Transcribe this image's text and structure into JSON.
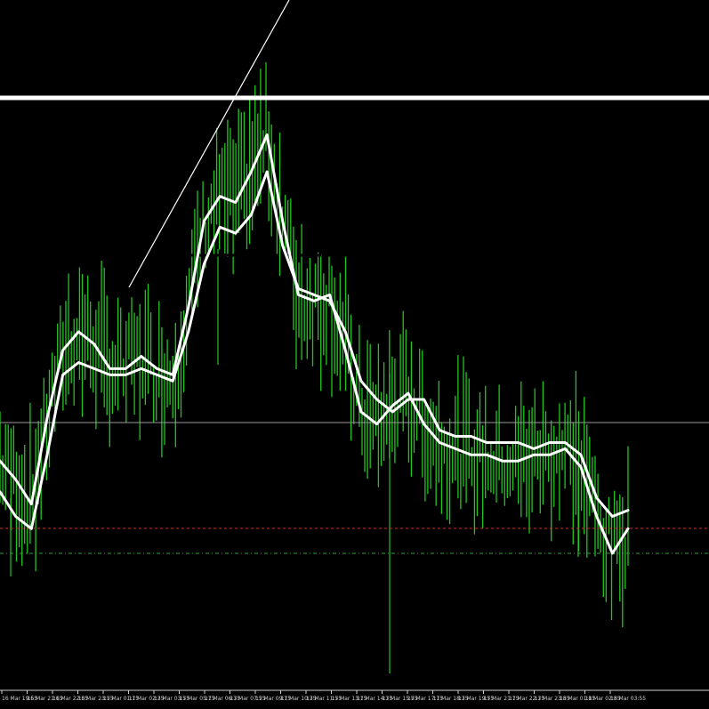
{
  "colors": {
    "background": "#000000",
    "price": "#22c41e",
    "ma": "#ffffff",
    "hline_major": "#ffffff",
    "hline_minor": "#9a9a9a",
    "hline_red": "#c0392b",
    "hline_green": "#2e9e3a",
    "axis": "#cfcfcf"
  },
  "chart_data": {
    "type": "line",
    "grid": false,
    "ylim": [
      0,
      100
    ],
    "x_tick_labels": [
      "16 Mar 19:55",
      "16 Mar 21:15",
      "16 Mar 22:35",
      "16 Mar 23:55",
      "17 Mar 01:15",
      "17 Mar 02:35",
      "17 Mar 03:55",
      "17 Mar 05:15",
      "17 Mar 06:35",
      "17 Mar 07:55",
      "17 Mar 09:15",
      "17 Mar 10:35",
      "17 Mar 11:55",
      "17 Mar 13:15",
      "17 Mar 14:35",
      "17 Mar 15:55",
      "17 Mar 17:15",
      "17 Mar 18:35",
      "17 Mar 19:55",
      "17 Mar 21:15",
      "17 Mar 22:35",
      "17 Mar 23:55",
      "18 Mar 01:15",
      "18 Mar 02:35",
      "18 Mar 03:55"
    ],
    "series": [
      {
        "role": "ma_fast",
        "values": [
          39,
          36,
          32,
          46,
          57,
          60,
          58,
          54,
          54,
          56,
          54,
          53,
          64,
          78,
          82,
          81,
          86,
          92,
          78,
          66,
          65,
          66,
          57,
          47,
          45,
          48,
          50,
          45,
          42,
          41,
          40,
          40,
          39,
          39,
          40,
          40,
          41,
          38,
          30,
          24,
          28
        ]
      },
      {
        "role": "ma_slow",
        "values": [
          34,
          30,
          28,
          40,
          53,
          55,
          54,
          53,
          53,
          54,
          53,
          52,
          60,
          71,
          77,
          76,
          79,
          86,
          74,
          67,
          66,
          65,
          60,
          52,
          49,
          47,
          49,
          49,
          44,
          43,
          43,
          42,
          42,
          42,
          41,
          42,
          42,
          40,
          33,
          30,
          31
        ]
      }
    ],
    "horizontal_levels": [
      {
        "role": "resistance_bold",
        "value": 98
      },
      {
        "role": "ref",
        "value": 44
      },
      {
        "role": "red_dashed",
        "value": 26
      },
      {
        "role": "green_dashed",
        "value": 24
      }
    ]
  }
}
